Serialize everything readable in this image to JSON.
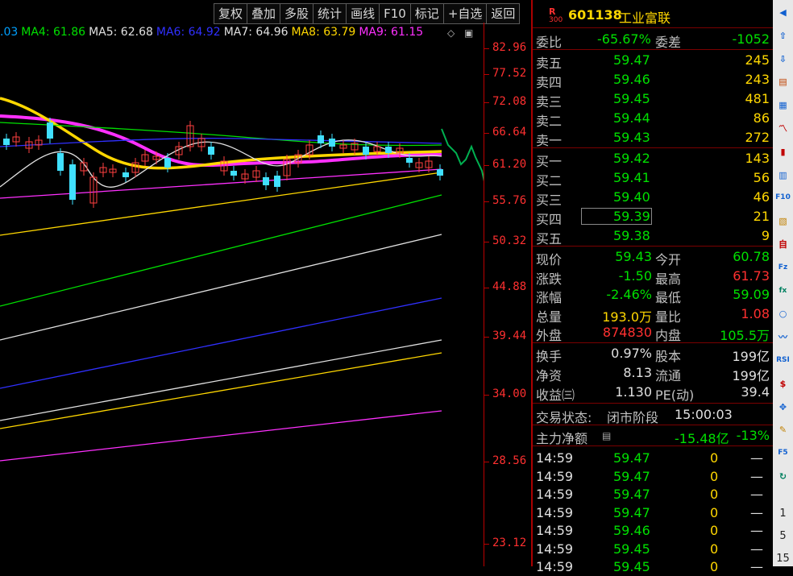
{
  "toolbar": {
    "items": [
      "复权",
      "叠加",
      "多股",
      "统计",
      "画线",
      "F10",
      "标记",
      "+自选",
      "返回"
    ]
  },
  "ma_legend": [
    {
      "label": ".03",
      "color": "#00a0ff"
    },
    {
      "label": "MA4: 61.86",
      "color": "#00e000"
    },
    {
      "label": "MA5: 62.68",
      "color": "#e0e0e0"
    },
    {
      "label": "MA6: 64.92",
      "color": "#3030ff"
    },
    {
      "label": "MA7: 64.96",
      "color": "#e0e0e0"
    },
    {
      "label": "MA8: 63.79",
      "color": "#ffd700"
    },
    {
      "label": "MA9: 61.15",
      "color": "#ff30ff"
    }
  ],
  "price_axis": {
    "ticks": [
      "82.96",
      "77.52",
      "72.08",
      "66.64",
      "61.20",
      "55.76",
      "50.32",
      "44.88",
      "39.44",
      "34.00",
      "28.56",
      "23.12"
    ]
  },
  "quote": {
    "badge": "R",
    "badge_sub": "300",
    "code": "601138",
    "name": "工业富联",
    "weibi_label": "委比",
    "weibi": "-65.67%",
    "weicha_label": "委差",
    "weicha": "-1052",
    "asks": [
      {
        "label": "卖五",
        "price": "59.47",
        "vol": "245"
      },
      {
        "label": "卖四",
        "price": "59.46",
        "vol": "243"
      },
      {
        "label": "卖三",
        "price": "59.45",
        "vol": "481"
      },
      {
        "label": "卖二",
        "price": "59.44",
        "vol": "86"
      },
      {
        "label": "卖一",
        "price": "59.43",
        "vol": "272"
      }
    ],
    "bids": [
      {
        "label": "买一",
        "price": "59.42",
        "vol": "143"
      },
      {
        "label": "买二",
        "price": "59.41",
        "vol": "56"
      },
      {
        "label": "买三",
        "price": "59.40",
        "vol": "46"
      },
      {
        "label": "买四",
        "price": "59.39",
        "vol": "21"
      },
      {
        "label": "买五",
        "price": "59.38",
        "vol": "9"
      }
    ],
    "stats": [
      {
        "l1": "现价",
        "v1": "59.43",
        "c1": "green",
        "l2": "今开",
        "v2": "60.78",
        "c2": "green"
      },
      {
        "l1": "涨跌",
        "v1": "-1.50",
        "c1": "green",
        "l2": "最高",
        "v2": "61.73",
        "c2": "red"
      },
      {
        "l1": "涨幅",
        "v1": "-2.46%",
        "c1": "green",
        "l2": "最低",
        "v2": "59.09",
        "c2": "green"
      },
      {
        "l1": "总量",
        "v1": "193.0万",
        "c1": "yellow",
        "l2": "量比",
        "v2": "1.08",
        "c2": "red"
      },
      {
        "l1": "外盘",
        "v1": "874830",
        "c1": "red",
        "l2": "内盘",
        "v2": "105.5万",
        "c2": "green"
      }
    ],
    "fundamentals": [
      {
        "l1": "换手",
        "v1": "0.97%",
        "l2": "股本",
        "v2": "199亿"
      },
      {
        "l1": "净资",
        "v1": "8.13",
        "l2": "流通",
        "v2": "199亿"
      },
      {
        "l1": "收益㈢",
        "v1": "1.130",
        "l2": "PE(动)",
        "v2": "39.4"
      }
    ],
    "trade_status_label": "交易状态:",
    "trade_status": "闭市阶段",
    "trade_time": "15:00:03",
    "main_flow_label": "主力净额",
    "main_flow": "-15.48亿",
    "main_flow_pct": "-13%",
    "ticks": [
      {
        "time": "14:59",
        "price": "59.47",
        "vol": "0",
        "dir": "—"
      },
      {
        "time": "14:59",
        "price": "59.47",
        "vol": "0",
        "dir": "—"
      },
      {
        "time": "14:59",
        "price": "59.47",
        "vol": "0",
        "dir": "—"
      },
      {
        "time": "14:59",
        "price": "59.47",
        "vol": "0",
        "dir": "—"
      },
      {
        "time": "14:59",
        "price": "59.46",
        "vol": "0",
        "dir": "—"
      },
      {
        "time": "14:59",
        "price": "59.45",
        "vol": "0",
        "dir": "—"
      },
      {
        "time": "14:59",
        "price": "59.45",
        "vol": "0",
        "dir": "—"
      }
    ]
  },
  "sidebar": {
    "icons": [
      "pin-icon",
      "arrow-up-icon",
      "arrow-down-icon",
      "report-icon",
      "grid-icon",
      "line-chart-icon",
      "kline-icon",
      "list-icon",
      "f10-icon",
      "f-icon",
      "self-icon",
      "fz-icon",
      "fx-icon",
      "circle-icon",
      "wave-icon",
      "rsi-icon",
      "dollar-icon",
      "move-icon",
      "pencil-icon",
      "f5-icon",
      "refresh-icon"
    ],
    "labels": {
      "rsi": "RSI",
      "f10": "F10",
      "fz": "Fz",
      "f5": "F5"
    },
    "numbers": [
      "1",
      "5",
      "15"
    ]
  }
}
